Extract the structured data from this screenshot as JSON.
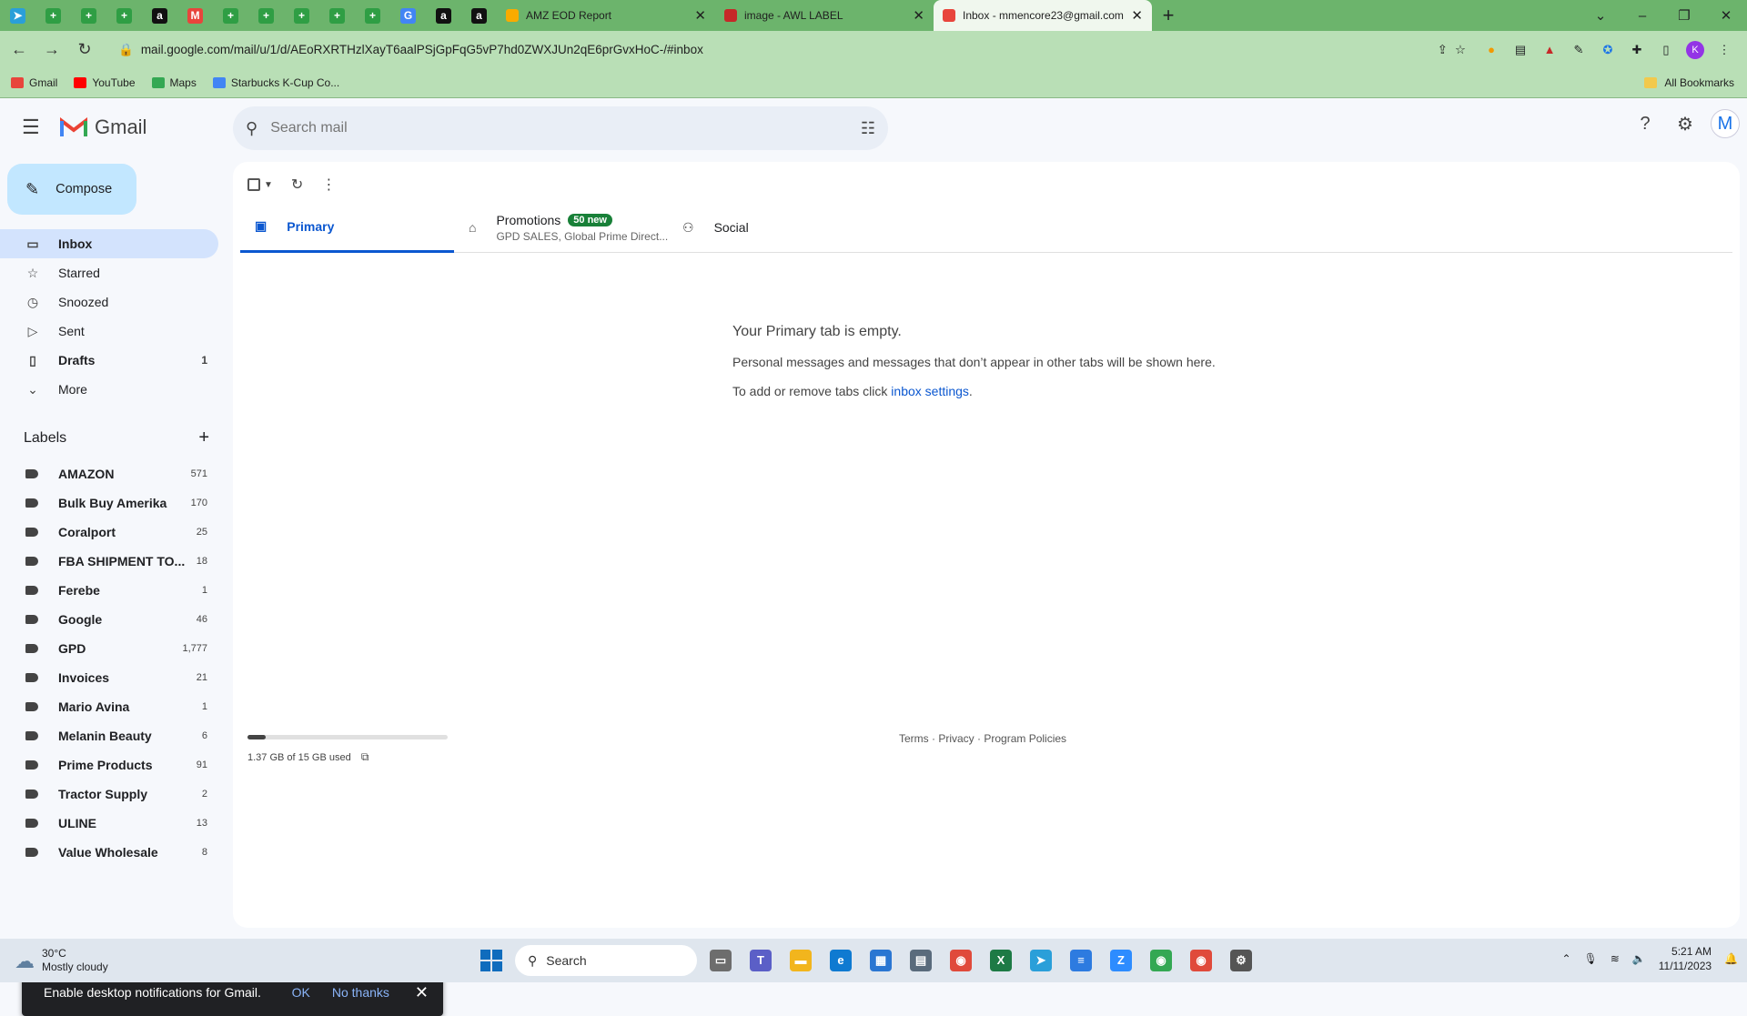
{
  "browser": {
    "pinned_tabs": [
      {
        "icon": "telegram-icon",
        "color": "#2a9fd9",
        "glyph": "➤"
      },
      {
        "icon": "sheets-icon",
        "color": "#2f9e44",
        "glyph": "+"
      },
      {
        "icon": "sheets-icon",
        "color": "#2f9e44",
        "glyph": "+"
      },
      {
        "icon": "sheets-icon",
        "color": "#2f9e44",
        "glyph": "+"
      },
      {
        "icon": "amazon-icon",
        "color": "#111",
        "glyph": "a"
      },
      {
        "icon": "gmail-icon",
        "color": "#e8453c",
        "glyph": "M"
      },
      {
        "icon": "sheets-icon",
        "color": "#2f9e44",
        "glyph": "+"
      },
      {
        "icon": "sheets-icon",
        "color": "#2f9e44",
        "glyph": "+"
      },
      {
        "icon": "sheets-icon",
        "color": "#2f9e44",
        "glyph": "+"
      },
      {
        "icon": "sheets-icon",
        "color": "#2f9e44",
        "glyph": "+"
      },
      {
        "icon": "sheets-icon",
        "color": "#2f9e44",
        "glyph": "+"
      },
      {
        "icon": "google-icon",
        "color": "#4285f4",
        "glyph": "G"
      },
      {
        "icon": "amazon-icon",
        "color": "#111",
        "glyph": "a"
      },
      {
        "icon": "amazon-icon",
        "color": "#111",
        "glyph": "a"
      }
    ],
    "tabs": [
      {
        "title": "AMZ EOD Report",
        "icon": "report-icon",
        "color": "#f9ab00"
      },
      {
        "title": "image - AWL LABEL",
        "icon": "awl-icon",
        "color": "#c62828"
      },
      {
        "title": "Inbox - mmencore23@gmail.com",
        "icon": "gmail-icon",
        "color": "#e8453c"
      }
    ],
    "url": "mail.google.com/mail/u/1/d/AEoRXRTHzlXayT6aalPSjGpFqG5vP7hd0ZWXJUn2qE6prGvxHoC-/#inbox",
    "bookmarks": [
      {
        "label": "Gmail",
        "color": "#e8453c"
      },
      {
        "label": "YouTube",
        "color": "#ff0000"
      },
      {
        "label": "Maps",
        "color": "#34a853"
      },
      {
        "label": "Starbucks K-Cup Co...",
        "color": "#4285f4"
      }
    ],
    "all_bookmarks": "All Bookmarks",
    "profile_initial": "K"
  },
  "gmail": {
    "logo_text": "Gmail",
    "search_placeholder": "Search mail",
    "avatar_initial": "M",
    "compose": "Compose",
    "nav": [
      {
        "label": "Inbox",
        "icon": "inbox-icon",
        "glyph": "▭",
        "count": "",
        "active": true,
        "bold": true
      },
      {
        "label": "Starred",
        "icon": "star-icon",
        "glyph": "☆",
        "count": "",
        "active": false,
        "bold": false
      },
      {
        "label": "Snoozed",
        "icon": "clock-icon",
        "glyph": "◷",
        "count": "",
        "active": false,
        "bold": false
      },
      {
        "label": "Sent",
        "icon": "send-icon",
        "glyph": "▷",
        "count": "",
        "active": false,
        "bold": false
      },
      {
        "label": "Drafts",
        "icon": "draft-icon",
        "glyph": "▯",
        "count": "1",
        "active": false,
        "bold": true
      },
      {
        "label": "More",
        "icon": "chevron-down-icon",
        "glyph": "⌄",
        "count": "",
        "active": false,
        "bold": false
      }
    ],
    "labels_title": "Labels",
    "labels": [
      {
        "label": "AMAZON",
        "count": "571"
      },
      {
        "label": "Bulk Buy Amerika",
        "count": "170"
      },
      {
        "label": "Coralport",
        "count": "25"
      },
      {
        "label": "FBA SHIPMENT TO...",
        "count": "18"
      },
      {
        "label": "Ferebe",
        "count": "1"
      },
      {
        "label": "Google",
        "count": "46"
      },
      {
        "label": "GPD",
        "count": "1,777"
      },
      {
        "label": "Invoices",
        "count": "21"
      },
      {
        "label": "Mario Avina",
        "count": "1"
      },
      {
        "label": "Melanin Beauty",
        "count": "6"
      },
      {
        "label": "Prime Products",
        "count": "91"
      },
      {
        "label": "Tractor Supply",
        "count": "2"
      },
      {
        "label": "ULINE",
        "count": "13"
      },
      {
        "label": "Value Wholesale",
        "count": "8"
      }
    ],
    "tabs": {
      "primary": "Primary",
      "promotions": "Promotions",
      "promotions_badge": "50 new",
      "promotions_sub": "GPD SALES, Global Prime Direct...",
      "social": "Social"
    },
    "empty": {
      "heading": "Your Primary tab is empty.",
      "line1": "Personal messages and messages that don’t appear in other tabs will be shown here.",
      "line2_prefix": "To add or remove tabs click ",
      "line2_link": "inbox settings",
      "line2_suffix": "."
    },
    "storage": {
      "text": "1.37 GB of 15 GB used",
      "fraction": 0.09
    },
    "footer": {
      "terms": "Terms",
      "privacy": "Privacy",
      "policies": "Program Policies",
      "dot": " · "
    },
    "toast": {
      "message": "Enable desktop notifications for Gmail.",
      "ok": "OK",
      "no": "No thanks"
    }
  },
  "taskbar": {
    "temp": "30°C",
    "weather": "Mostly cloudy",
    "search": "Search",
    "time": "5:21 AM",
    "date": "11/11/2023",
    "apps": [
      {
        "icon": "file-explorer-icon",
        "color": "#6d6d6d",
        "glyph": "▭"
      },
      {
        "icon": "teams-icon",
        "color": "#5b5fc7",
        "glyph": "T"
      },
      {
        "icon": "folder-icon",
        "color": "#f2b51d",
        "glyph": "▬"
      },
      {
        "icon": "edge-icon",
        "color": "#0f7ad1",
        "glyph": "e"
      },
      {
        "icon": "store-icon",
        "color": "#2a76d2",
        "glyph": "▦"
      },
      {
        "icon": "calculator-icon",
        "color": "#5a6b7c",
        "glyph": "▤"
      },
      {
        "icon": "chrome-icon",
        "color": "#e04a3b",
        "glyph": "◉"
      },
      {
        "icon": "excel-icon",
        "color": "#1d7a45",
        "glyph": "X"
      },
      {
        "icon": "telegram-icon",
        "color": "#2a9fd9",
        "glyph": "➤"
      },
      {
        "icon": "notepad-icon",
        "color": "#2d7be0",
        "glyph": "≡"
      },
      {
        "icon": "zoom-icon",
        "color": "#2d8cff",
        "glyph": "Z"
      },
      {
        "icon": "chrome-icon",
        "color": "#34a853",
        "glyph": "◉"
      },
      {
        "icon": "chrome-icon",
        "color": "#e04a3b",
        "glyph": "◉"
      },
      {
        "icon": "settings-icon",
        "color": "#555",
        "glyph": "⚙"
      }
    ]
  }
}
